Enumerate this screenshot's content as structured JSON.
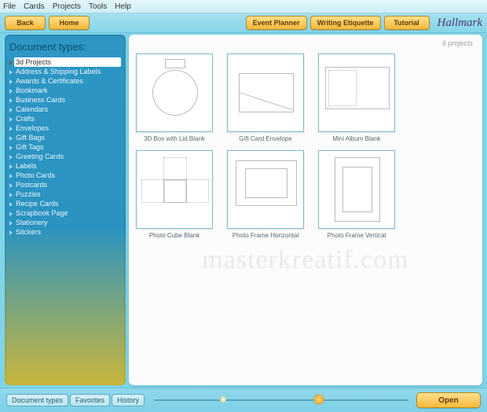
{
  "menu": {
    "file": "File",
    "cards": "Cards",
    "projects": "Projects",
    "tools": "Tools",
    "help": "Help"
  },
  "toolbar": {
    "back": "Back",
    "home": "Home",
    "event": "Event Planner",
    "etiquette": "Writing Etiquette",
    "tutorial": "Tutorial",
    "brand": "Hallmark"
  },
  "sidebar": {
    "title": "Document types:",
    "items": [
      "3d Projects",
      "Address & Shipping Labels",
      "Awards & Certificates",
      "Bookmark",
      "Business Cards",
      "Calendars",
      "Crafts",
      "Envelopes",
      "Gift Bags",
      "Gift Tags",
      "Greeting Cards",
      "Labels",
      "Photo Cards",
      "Postcards",
      "Puzzles",
      "Recipe Cards",
      "Scrapbook Page",
      "Stationery",
      "Stickers"
    ],
    "active": 0
  },
  "counter": "6  projects",
  "projects": [
    {
      "label": "3D Box with Lid Blank"
    },
    {
      "label": "Gift Card Envelope"
    },
    {
      "label": "Mini Album Blank"
    },
    {
      "label": "Photo Cube Blank"
    },
    {
      "label": "Photo Frame Horizontal"
    },
    {
      "label": "Photo Frame Vertical"
    }
  ],
  "watermark": "masterkreatif.com",
  "footer": {
    "tab1": "Document types",
    "tab2": "Favorites",
    "tab3": "History",
    "open": "Open"
  }
}
